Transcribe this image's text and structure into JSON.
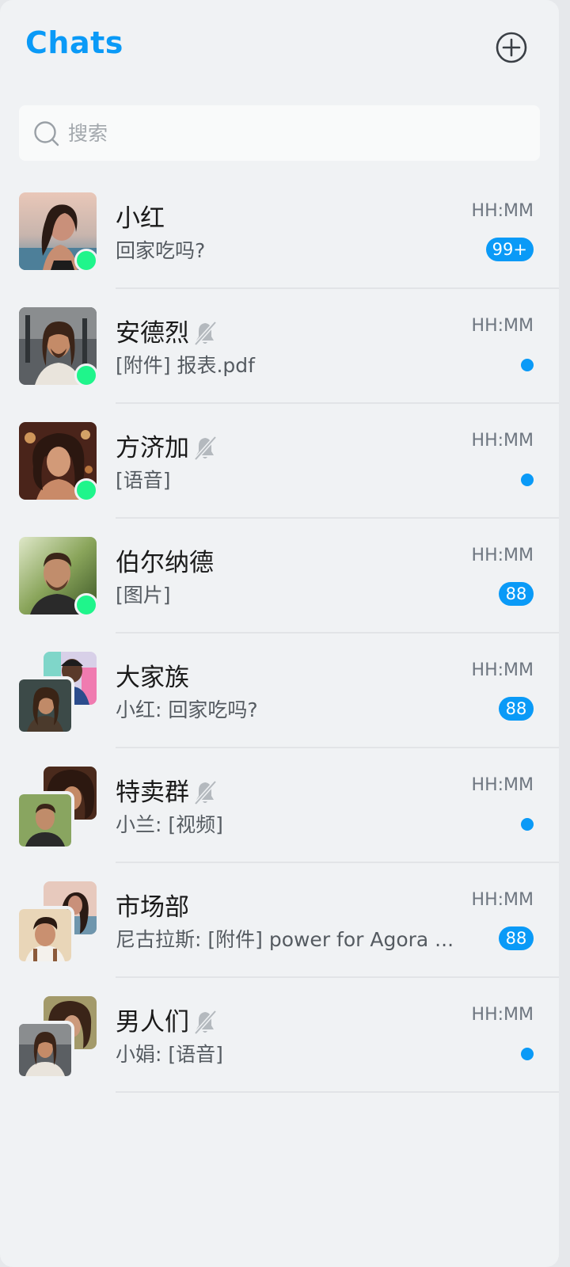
{
  "header": {
    "title": "Chats",
    "add_icon": "plus-circle-icon"
  },
  "search": {
    "placeholder": "搜索",
    "icon": "search-icon"
  },
  "colors": {
    "accent": "#0a9af7",
    "presence": "#1ff58b",
    "background": "#f0f2f4"
  },
  "conversations": [
    {
      "name": "小红",
      "preview": "回家吃吗?",
      "time": "HH:MM",
      "badge": "99+",
      "muted": false,
      "online": true,
      "group": false
    },
    {
      "name": "安德烈",
      "preview": "[附件] 报表.pdf",
      "time": "HH:MM",
      "badge": "",
      "muted": true,
      "online": true,
      "group": false
    },
    {
      "name": "方济加",
      "preview": "[语音]",
      "time": "HH:MM",
      "badge": "",
      "muted": true,
      "online": true,
      "group": false
    },
    {
      "name": "伯尔纳德",
      "preview": "[图片]",
      "time": "HH:MM",
      "badge": "88",
      "muted": false,
      "online": true,
      "group": false
    },
    {
      "name": "大家族",
      "preview": "小红: 回家吃吗?",
      "time": "HH:MM",
      "badge": "88",
      "muted": false,
      "online": false,
      "group": true
    },
    {
      "name": "特卖群",
      "preview": "小兰: [视频]",
      "time": "HH:MM",
      "badge": "",
      "muted": true,
      "online": false,
      "group": true
    },
    {
      "name": "市场部",
      "preview": "尼古拉斯: [附件] power for Agora ...",
      "time": "HH:MM",
      "badge": "88",
      "muted": false,
      "online": false,
      "group": true
    },
    {
      "name": "男人们",
      "preview": "小娟: [语音]",
      "time": "HH:MM",
      "badge": "",
      "muted": true,
      "online": false,
      "group": true
    }
  ]
}
